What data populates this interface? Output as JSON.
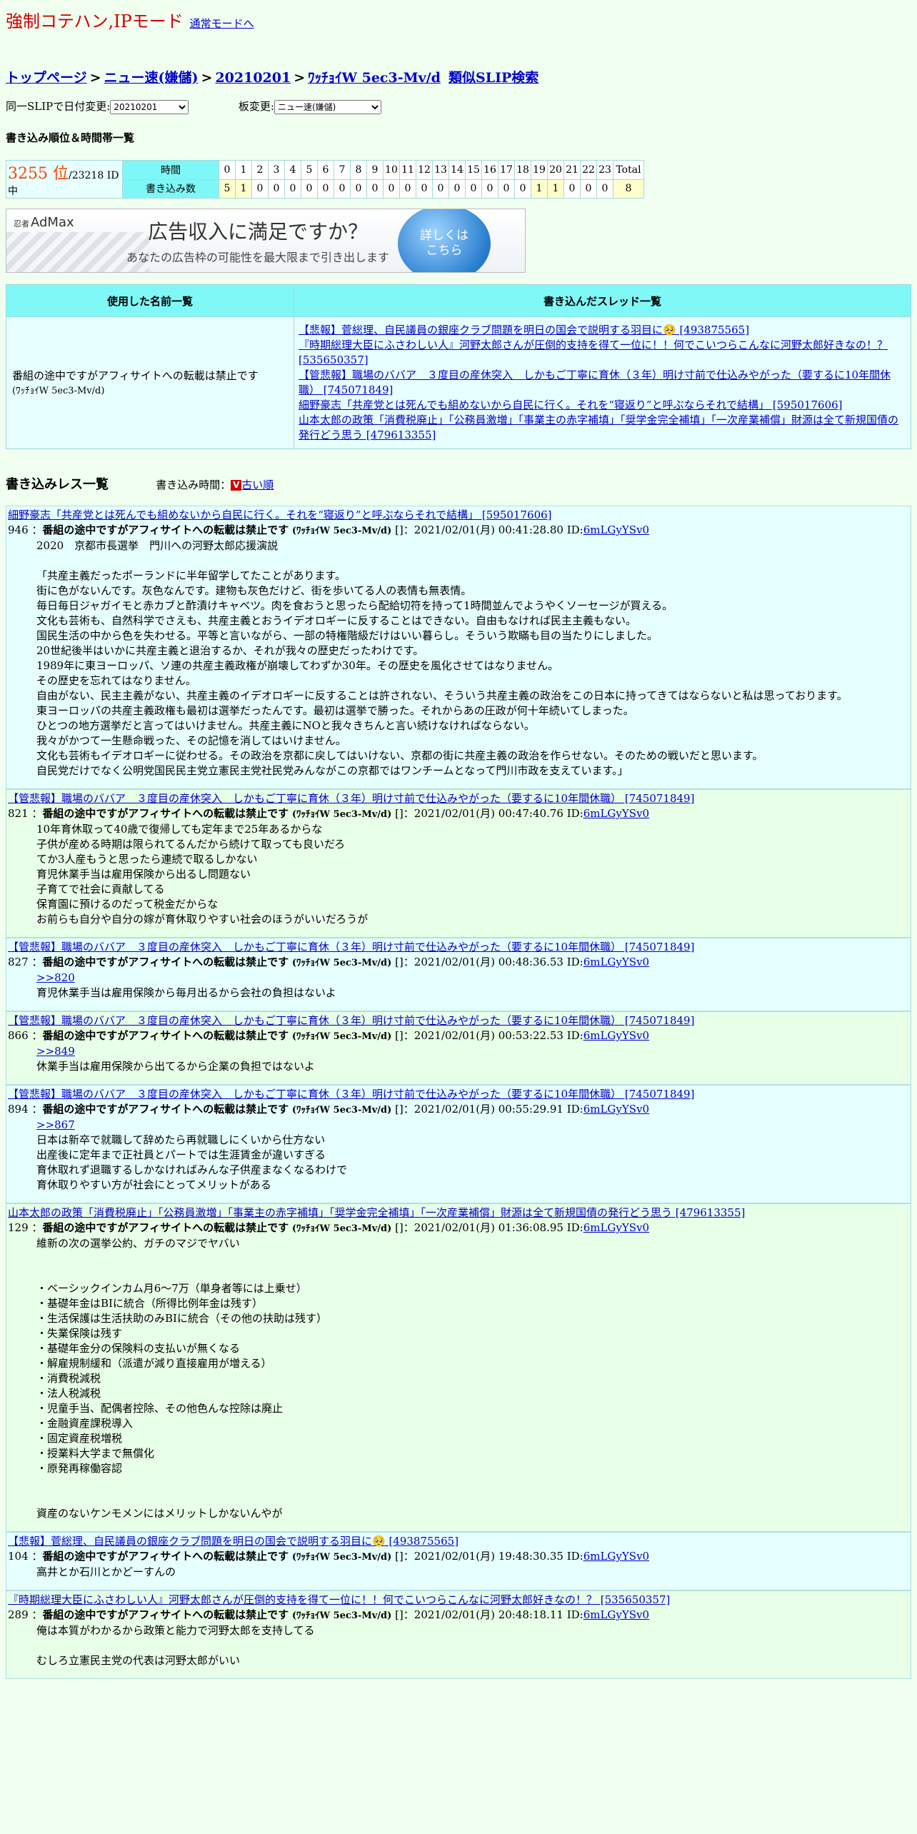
{
  "mode": {
    "title": "強制コテハン,IPモード",
    "link": "通常モードへ"
  },
  "breadcrumb": {
    "top": "トップページ",
    "sep": ">",
    "board": "ニュー速(嫌儲)",
    "date": "20210201",
    "id": "ﾜｯﾁｮｲW 5ec3-Mv/d",
    "similar": "類似SLIP検索"
  },
  "selectors": {
    "date_label": "同一SLIPで日付変更:",
    "date_value": "20210201",
    "board_label": "板変更:",
    "board_value": "ニュー速(嫌儲)"
  },
  "rank": {
    "heading": "書き込み順位＆時間帯一覧",
    "position": "3255 位",
    "total": "/23218 ID中",
    "time_label": "時間",
    "count_label": "書き込み数",
    "hours": [
      "0",
      "1",
      "2",
      "3",
      "4",
      "5",
      "6",
      "7",
      "8",
      "9",
      "10",
      "11",
      "12",
      "13",
      "14",
      "15",
      "16",
      "17",
      "18",
      "19",
      "20",
      "21",
      "22",
      "23",
      "Total"
    ],
    "counts": [
      "5",
      "1",
      "0",
      "0",
      "0",
      "0",
      "0",
      "0",
      "0",
      "0",
      "0",
      "0",
      "0",
      "0",
      "0",
      "0",
      "0",
      "0",
      "0",
      "1",
      "1",
      "0",
      "0",
      "0",
      "8"
    ]
  },
  "ad": {
    "logo_small": "忍者",
    "logo": "AdMax",
    "main": "広告収入に満足ですか？",
    "sub": "あなたの広告枠の可能性を最大限まで引き出します",
    "button": "詳しくは\nこちら"
  },
  "info": {
    "names_header": "使用した名前一覧",
    "threads_header": "書き込んだスレッド一覧",
    "name": "番組の途中ですがアフィサイトへの転載は禁止です",
    "name_trip": "(ﾜｯﾁｮｲW 5ec3-Mv/d)",
    "threads": [
      "【悲報】菅総理、自民議員の銀座クラブ問題を明日の国会で説明する羽目に🥺 [493875565]",
      "『時期総理大臣にふさわしい人』河野太郎さんが圧倒的支持を得て一位に！！何でこいつらこんなに河野太郎好きなの！？ [535650357]",
      "【管悲報】職場のババア　３度目の産休突入　しかもご丁寧に育休（３年）明け寸前で仕込みやがった（要するに10年間休職） [745071849]",
      "細野豪志「共産党とは死んでも組めないから自民に行く。それを“寝返り”と呼ぶならそれで結構」 [595017606]",
      "山本太郎の政策「消費税廃止」「公務員激増」「事業主の赤字補填」「奨学金完全補填」「一次産業補償」財源は全て新規国債の発行どう思う [479613355]"
    ]
  },
  "posts_section": {
    "title": "書き込みレス一覧",
    "order_label": "書き込み時間：",
    "order_icon": "V",
    "order_link": "古い順"
  },
  "posts": [
    {
      "thread": "細野豪志「共産党とは死んでも組めないから自民に行く。それを“寝返り”と呼ぶならそれで結構」 [595017606]",
      "num": "946",
      "name": "番組の途中ですがアフィサイトへの転載は禁止です",
      "trip": "(ﾜｯﾁｮｲW 5ec3-Mv/d)",
      "meta": " []：2021/02/01(月) 00:41:28.80 ID:",
      "id": "6mLGyYSv0",
      "reply": "",
      "body": "2020　京都市長選挙　門川への河野太郎応援演説\n\n「共産主義だったポーランドに半年留学してたことがあります。\n街に色がないんです。灰色なんです。建物も灰色だけど、街を歩いてる人の表情も無表情。\n毎日毎日ジャガイモと赤カブと酢漬けキャベツ。肉を食おうと思ったら配給切符を持って1時間並んでようやくソーセージが買える。\n文化も芸術も、自然科学でさえも、共産主義とおうイデオロギーに反することはできない。自由もなければ民主主義もない。\n国民生活の中から色を失わせる。平等と言いながら、一部の特権階級だけはいい暮らし。そういう欺瞞も目の当たりにしました。\n20世紀後半はいかに共産主義と退治するか、それが我々の歴史だったわけです。\n1989年に東ヨーロッパ、ソ連の共産主義政権が崩壊してわずか30年。その歴史を風化させてはなりません。\nその歴史を忘れてはなりません。\n自由がない、民主主義がない、共産主義のイデオロギーに反することは許されない、そういう共産主義の政治をこの日本に持ってきてはならないと私は思っております。\n東ヨーロッパの共産主義政権も最初は選挙だったんです。最初は選挙で勝った。それからあの圧政が何十年続いてしまった。\nひとつの地方選挙だと言ってはいけません。共産主義にNOと我々きちんと言い続けなければならない。\n我々がかつて一生懸命戦った、その記憶を消してはいけません。\n文化も芸術もイデオロギーに従わせる。その政治を京都に戻してはいけない、京都の街に共産主義の政治を作らせない。そのための戦いだと思います。\n自民党だけでなく公明党国民民主党立憲民主党社民党みんながこの京都ではワンチームとなって門川市政を支えています。」"
    },
    {
      "thread": "【管悲報】職場のババア　３度目の産休突入　しかもご丁寧に育休（３年）明け寸前で仕込みやがった（要するに10年間休職） [745071849]",
      "num": "821",
      "name": "番組の途中ですがアフィサイトへの転載は禁止です",
      "trip": "(ﾜｯﾁｮｲW 5ec3-Mv/d)",
      "meta": " []：2021/02/01(月) 00:47:40.76 ID:",
      "id": "6mLGyYSv0",
      "reply": "",
      "body": "10年育休取って40歳で復帰しても定年まで25年あるからな\n子供が産める時期は限られてるんだから続けて取っても良いだろ\nてか3人産もうと思ったら連続で取るしかない\n育児休業手当は雇用保険から出るし問題ない\n子育てで社会に貢献してる\n保育園に預けるのだって税金だからな\nお前らも自分や自分の嫁が育休取りやすい社会のほうがいいだろうが"
    },
    {
      "thread": "【管悲報】職場のババア　３度目の産休突入　しかもご丁寧に育休（３年）明け寸前で仕込みやがった（要するに10年間休職） [745071849]",
      "num": "827",
      "name": "番組の途中ですがアフィサイトへの転載は禁止です",
      "trip": "(ﾜｯﾁｮｲW 5ec3-Mv/d)",
      "meta": " []：2021/02/01(月) 00:48:36.53 ID:",
      "id": "6mLGyYSv0",
      "reply": ">>820",
      "body": "育児休業手当は雇用保険から毎月出るから会社の負担はないよ"
    },
    {
      "thread": "【管悲報】職場のババア　３度目の産休突入　しかもご丁寧に育休（３年）明け寸前で仕込みやがった（要するに10年間休職） [745071849]",
      "num": "866",
      "name": "番組の途中ですがアフィサイトへの転載は禁止です",
      "trip": "(ﾜｯﾁｮｲW 5ec3-Mv/d)",
      "meta": " []：2021/02/01(月) 00:53:22.53 ID:",
      "id": "6mLGyYSv0",
      "reply": ">>849",
      "body": "休業手当は雇用保険から出てるから企業の負担ではないよ"
    },
    {
      "thread": "【管悲報】職場のババア　３度目の産休突入　しかもご丁寧に育休（３年）明け寸前で仕込みやがった（要するに10年間休職） [745071849]",
      "num": "894",
      "name": "番組の途中ですがアフィサイトへの転載は禁止です",
      "trip": "(ﾜｯﾁｮｲW 5ec3-Mv/d)",
      "meta": " []：2021/02/01(月) 00:55:29.91 ID:",
      "id": "6mLGyYSv0",
      "reply": ">>867",
      "body": "日本は新卒で就職して辞めたら再就職しにくいから仕方ない\n出産後に定年まで正社員とパートでは生涯賃金が違いすぎる\n育休取れず退職するしかなければみんな子供産まなくなるわけで\n育休取りやすい方が社会にとってメリットがある"
    },
    {
      "thread": "山本太郎の政策「消費税廃止」「公務員激増」「事業主の赤字補填」「奨学金完全補填」「一次産業補償」財源は全て新規国債の発行どう思う [479613355]",
      "num": "129",
      "name": "番組の途中ですがアフィサイトへの転載は禁止です",
      "trip": "(ﾜｯﾁｮｲW 5ec3-Mv/d)",
      "meta": " []：2021/02/01(月) 01:36:08.95 ID:",
      "id": "6mLGyYSv0",
      "reply": "",
      "body": "維新の次の選挙公約、ガチのマジでヤバい\n\n\n・ベーシックインカム月6〜7万（単身者等には上乗せ）\n・基礎年金はBIに統合（所得比例年金は残す）\n・生活保護は生活扶助のみBIに統合（その他の扶助は残す）\n・失業保険は残す\n・基礎年金分の保険料の支払いが無くなる\n・解雇規制緩和（派遣が減り直接雇用が増える）\n・消費税減税\n・法人税減税\n・児童手当、配偶者控除、その他色んな控除は廃止\n・金融資産課税導入\n・固定資産税増税\n・授業料大学まで無償化\n・原発再稼働容認\n\n\n資産のないケンモメンにはメリットしかないんやが"
    },
    {
      "thread": "【悲報】菅総理、自民議員の銀座クラブ問題を明日の国会で説明する羽目に🥺 [493875565]",
      "num": "104",
      "name": "番組の途中ですがアフィサイトへの転載は禁止です",
      "trip": "(ﾜｯﾁｮｲW 5ec3-Mv/d)",
      "meta": " []：2021/02/01(月) 19:48:30.35 ID:",
      "id": "6mLGyYSv0",
      "reply": "",
      "body": "高井とか石川とかどーすんの"
    },
    {
      "thread": "『時期総理大臣にふさわしい人』河野太郎さんが圧倒的支持を得て一位に！！何でこいつらこんなに河野太郎好きなの！？ [535650357]",
      "num": "289",
      "name": "番組の途中ですがアフィサイトへの転載は禁止です",
      "trip": "(ﾜｯﾁｮｲW 5ec3-Mv/d)",
      "meta": " []：2021/02/01(月) 20:48:18.11 ID:",
      "id": "6mLGyYSv0",
      "reply": "",
      "body": "俺は本質がわかるから政策と能力で河野太郎を支持してる\n\nむしろ立憲民主党の代表は河野太郎がいい"
    }
  ]
}
